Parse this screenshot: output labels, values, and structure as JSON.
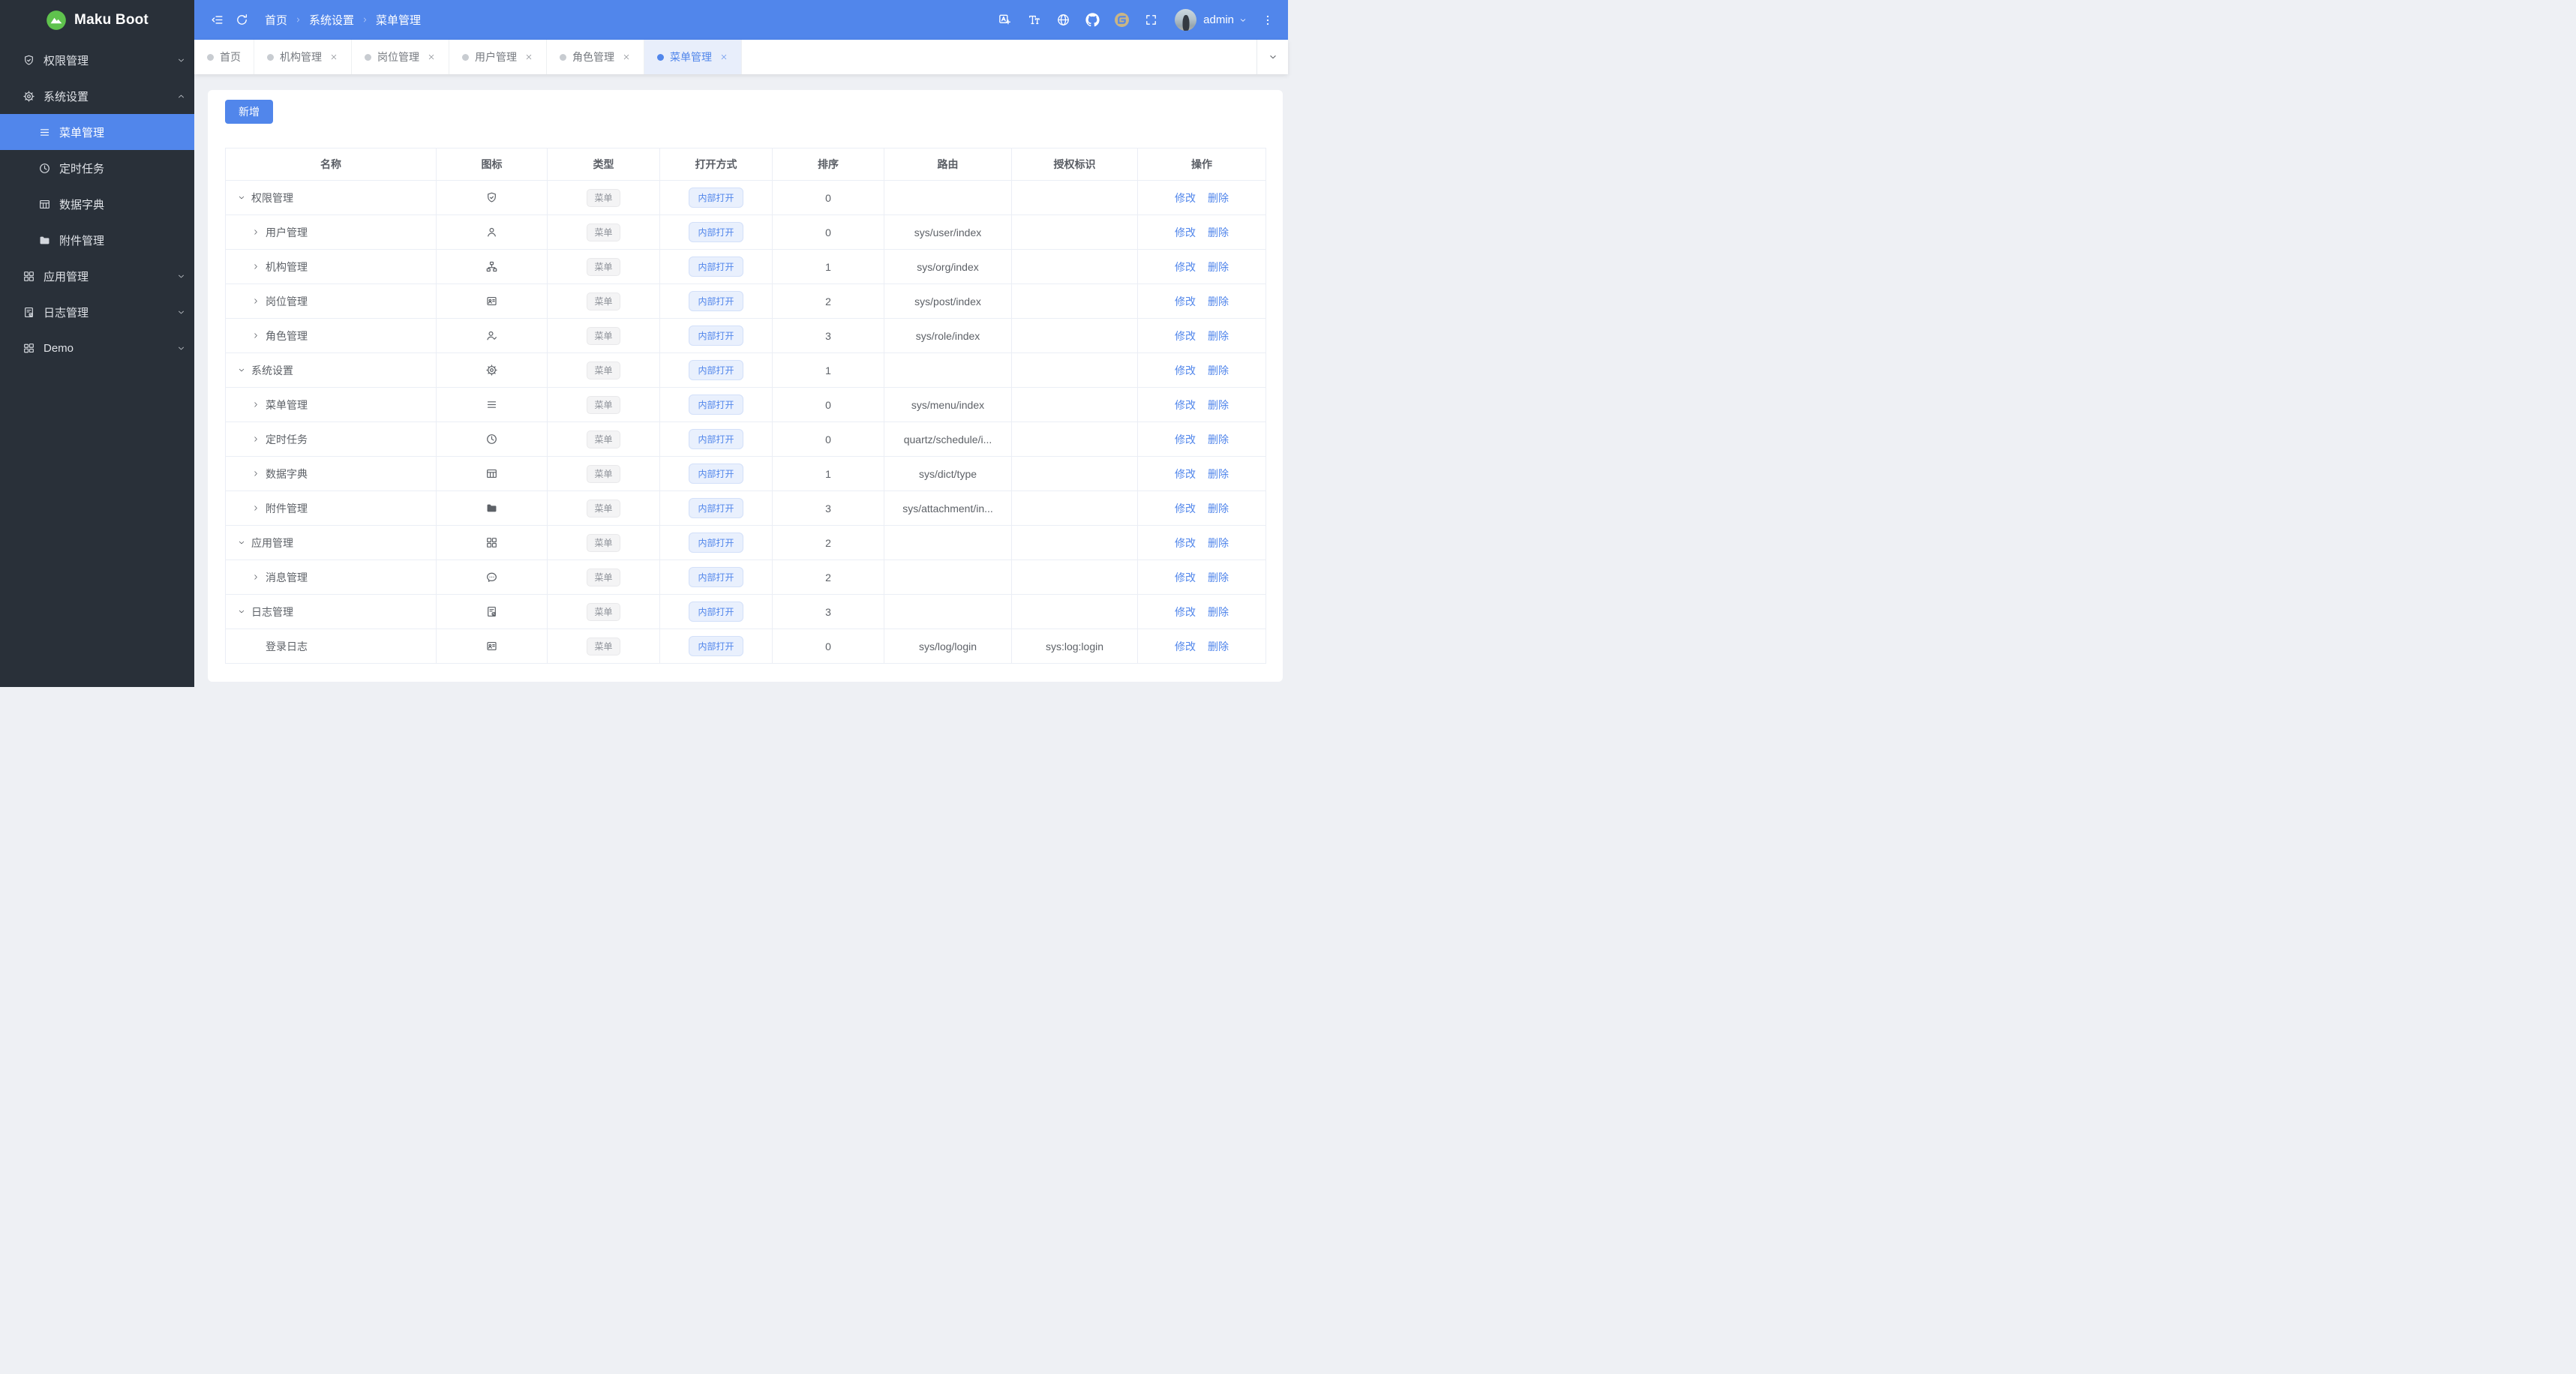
{
  "app": {
    "name": "Maku Boot",
    "colors": {
      "primary": "#5186eb",
      "sidebar_bg": "#293039",
      "page_bg": "#eef0f4",
      "active_tab_bg": "#e8eefb",
      "tag_primary_bg": "#e9f0fd",
      "tag_primary_text": "#5186eb",
      "tag_info_bg": "#f4f4f5",
      "tag_info_text": "#8f939a",
      "logo_green": "#5fc24d",
      "gitee_gold": "#c9b586"
    }
  },
  "sidebar": {
    "items": [
      {
        "label": "权限管理",
        "icon": "shield-check-icon",
        "state": "collapsed"
      },
      {
        "label": "系统设置",
        "icon": "gear-icon",
        "state": "expanded",
        "children": [
          {
            "label": "菜单管理",
            "icon": "menu-lines-icon",
            "active": true
          },
          {
            "label": "定时任务",
            "icon": "clock-icon"
          },
          {
            "label": "数据字典",
            "icon": "table-grid-icon"
          },
          {
            "label": "附件管理",
            "icon": "folder-icon"
          }
        ]
      },
      {
        "label": "应用管理",
        "icon": "grid-icon",
        "state": "collapsed"
      },
      {
        "label": "日志管理",
        "icon": "doc-check-icon",
        "state": "collapsed"
      },
      {
        "label": "Demo",
        "icon": "grid-alt-icon",
        "state": "collapsed"
      }
    ]
  },
  "header": {
    "breadcrumb": [
      "首页",
      "系统设置",
      "菜单管理"
    ],
    "actions": [
      {
        "icon": "translate-icon"
      },
      {
        "icon": "font-size-icon"
      },
      {
        "icon": "globe-icon"
      },
      {
        "icon": "github-icon"
      },
      {
        "icon": "gitee-icon"
      },
      {
        "icon": "fullscreen-icon"
      }
    ],
    "user": {
      "name": "admin"
    }
  },
  "tabs": [
    {
      "label": "首页",
      "closable": false,
      "active": false
    },
    {
      "label": "机构管理",
      "closable": true,
      "active": false
    },
    {
      "label": "岗位管理",
      "closable": true,
      "active": false
    },
    {
      "label": "用户管理",
      "closable": true,
      "active": false
    },
    {
      "label": "角色管理",
      "closable": true,
      "active": false
    },
    {
      "label": "菜单管理",
      "closable": true,
      "active": true
    }
  ],
  "toolbar": {
    "add_label": "新增"
  },
  "table": {
    "columns": [
      "名称",
      "图标",
      "类型",
      "打开方式",
      "排序",
      "路由",
      "授权标识",
      "操作"
    ],
    "labels": {
      "edit": "修改",
      "delete": "删除"
    },
    "rows": [
      {
        "name": "权限管理",
        "level": 0,
        "expand": "down",
        "icon": "shield-check-icon",
        "type": "菜单",
        "open_mode": "内部打开",
        "sort": "0",
        "route": "",
        "perm": ""
      },
      {
        "name": "用户管理",
        "level": 1,
        "expand": "right",
        "icon": "user-icon",
        "type": "菜单",
        "open_mode": "内部打开",
        "sort": "0",
        "route": "sys/user/index",
        "perm": ""
      },
      {
        "name": "机构管理",
        "level": 1,
        "expand": "right",
        "icon": "org-icon",
        "type": "菜单",
        "open_mode": "内部打开",
        "sort": "1",
        "route": "sys/org/index",
        "perm": ""
      },
      {
        "name": "岗位管理",
        "level": 1,
        "expand": "right",
        "icon": "idcard-icon",
        "type": "菜单",
        "open_mode": "内部打开",
        "sort": "2",
        "route": "sys/post/index",
        "perm": ""
      },
      {
        "name": "角色管理",
        "level": 1,
        "expand": "right",
        "icon": "user-check-icon",
        "type": "菜单",
        "open_mode": "内部打开",
        "sort": "3",
        "route": "sys/role/index",
        "perm": ""
      },
      {
        "name": "系统设置",
        "level": 0,
        "expand": "down",
        "icon": "gear-icon",
        "type": "菜单",
        "open_mode": "内部打开",
        "sort": "1",
        "route": "",
        "perm": ""
      },
      {
        "name": "菜单管理",
        "level": 1,
        "expand": "right",
        "icon": "menu-lines-icon",
        "type": "菜单",
        "open_mode": "内部打开",
        "sort": "0",
        "route": "sys/menu/index",
        "perm": ""
      },
      {
        "name": "定时任务",
        "level": 1,
        "expand": "right",
        "icon": "clock-icon",
        "type": "菜单",
        "open_mode": "内部打开",
        "sort": "0",
        "route": "quartz/schedule/i...",
        "perm": ""
      },
      {
        "name": "数据字典",
        "level": 1,
        "expand": "right",
        "icon": "table-grid-icon",
        "type": "菜单",
        "open_mode": "内部打开",
        "sort": "1",
        "route": "sys/dict/type",
        "perm": ""
      },
      {
        "name": "附件管理",
        "level": 1,
        "expand": "right",
        "icon": "folder-icon",
        "type": "菜单",
        "open_mode": "内部打开",
        "sort": "3",
        "route": "sys/attachment/in...",
        "perm": ""
      },
      {
        "name": "应用管理",
        "level": 0,
        "expand": "down",
        "icon": "grid-icon",
        "type": "菜单",
        "open_mode": "内部打开",
        "sort": "2",
        "route": "",
        "perm": ""
      },
      {
        "name": "消息管理",
        "level": 1,
        "expand": "right",
        "icon": "chat-icon",
        "type": "菜单",
        "open_mode": "内部打开",
        "sort": "2",
        "route": "",
        "perm": ""
      },
      {
        "name": "日志管理",
        "level": 0,
        "expand": "down",
        "icon": "doc-check-icon",
        "type": "菜单",
        "open_mode": "内部打开",
        "sort": "3",
        "route": "",
        "perm": ""
      },
      {
        "name": "登录日志",
        "level": 1,
        "expand": "none",
        "icon": "idcard-icon",
        "type": "菜单",
        "open_mode": "内部打开",
        "sort": "0",
        "route": "sys/log/login",
        "perm": "sys:log:login"
      }
    ]
  }
}
